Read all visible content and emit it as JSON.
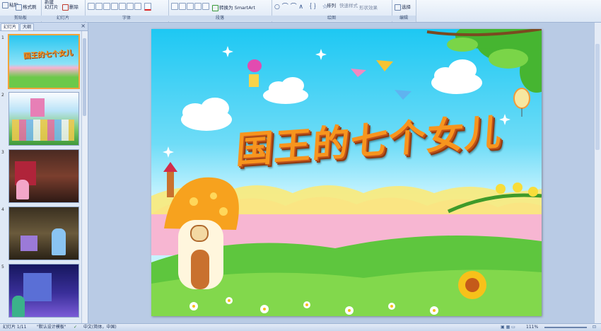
{
  "ribbon": {
    "groups": [
      "剪贴板",
      "幻灯片",
      "字体",
      "段落",
      "绘图",
      "编辑"
    ],
    "paste": "粘贴",
    "format_painter": "格式刷",
    "new_slide": "新建\n幻灯片",
    "delete": "删除",
    "convert_smartart": "转换为 SmartArt",
    "arrange": "排列",
    "quick_styles": "快速样式",
    "shape_effects": "形状效果",
    "select": "选择"
  },
  "panel": {
    "tab_slides": "幻灯片",
    "tab_outline": "大纲",
    "close": "×",
    "slide_numbers": [
      "1",
      "2",
      "3",
      "4",
      "5"
    ]
  },
  "slide": {
    "title": "国王的七个女儿",
    "thumb_title": "国王的七个女儿"
  },
  "status": {
    "slide_info": "幻灯片 1/11",
    "theme": "\"默认设计模板\"",
    "language": "中文(简体，中国)",
    "zoom": "111%"
  },
  "colors": {
    "sky": "#1ec8f3",
    "title_orange": "#f7951e",
    "grass": "#58c33a",
    "pink": "#f6a6c8"
  }
}
